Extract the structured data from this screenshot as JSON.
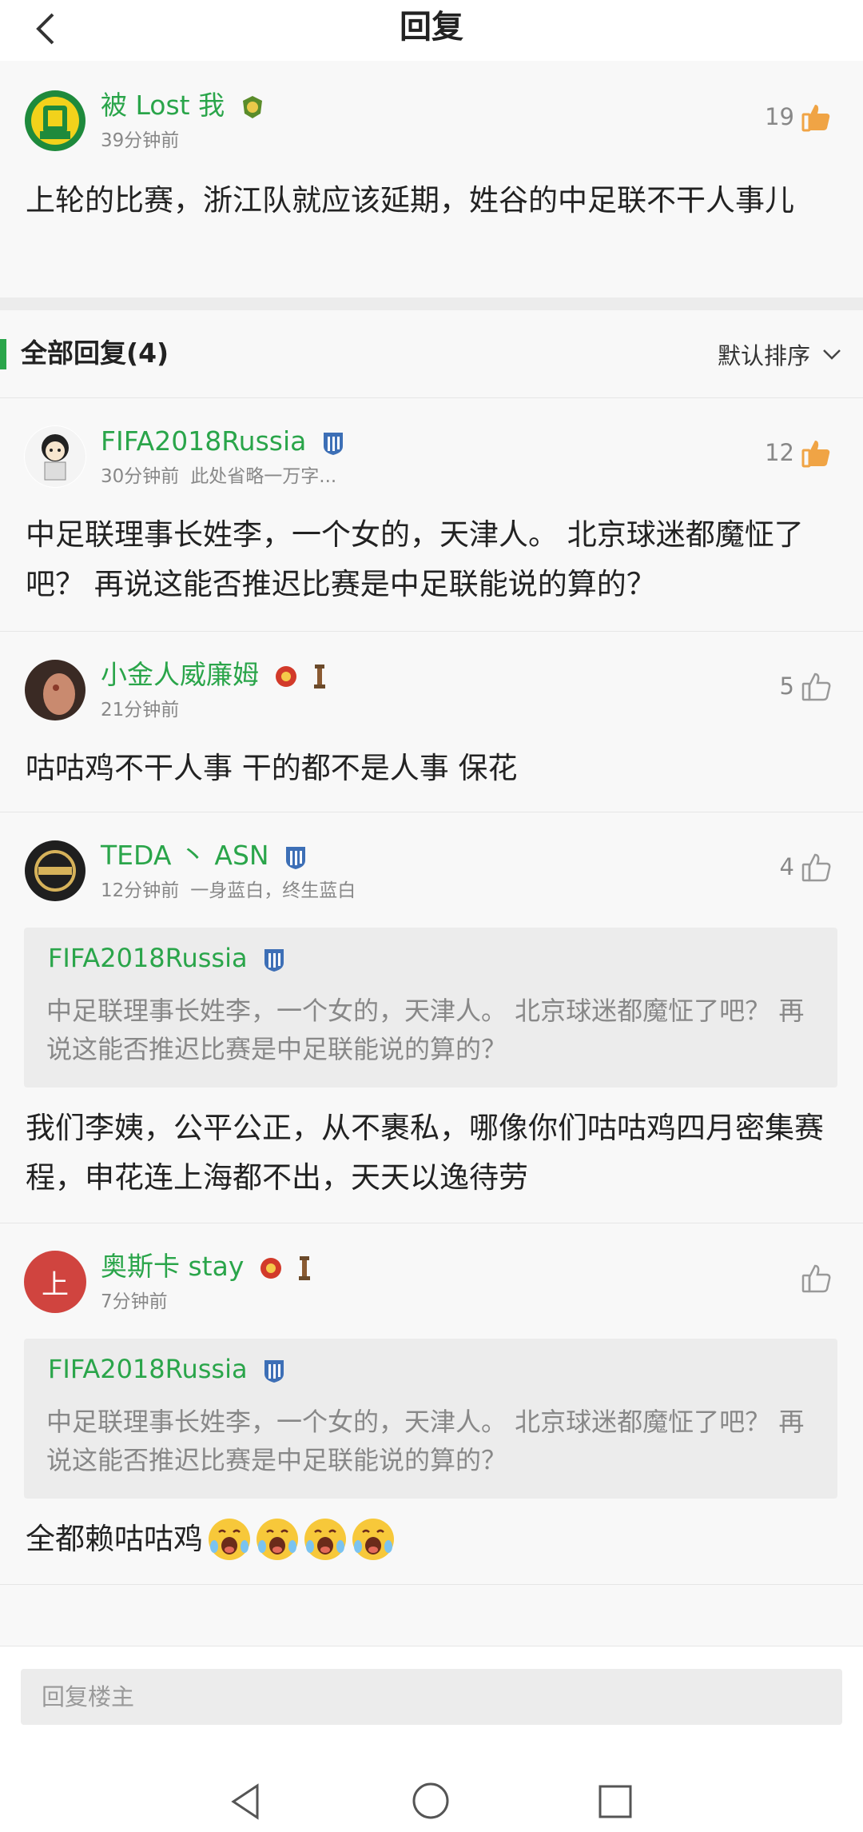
{
  "header": {
    "title": "回复"
  },
  "op": {
    "username": "被 Lost 我",
    "time": "39分钟前",
    "likes": "19",
    "text": "上轮的比赛，浙江队就应该延期，姓谷的中足联不干人事儿"
  },
  "section": {
    "title": "全部回复(4)",
    "sort_label": "默认排序"
  },
  "replies": [
    {
      "username": "FIFA2018Russia",
      "time": "30分钟前",
      "signature": "此处省略一万字...",
      "likes": "12",
      "text": "中足联理事长姓李，一个女的，天津人。 北京球迷都魔怔了吧？ 再说这能否推迟比赛是中足联能说的算的？"
    },
    {
      "username": "小金人威廉姆",
      "time": "21分钟前",
      "likes": "5",
      "text": "咕咕鸡不干人事 干的都不是人事 保花"
    },
    {
      "username": "TEDA 丶 ASN",
      "time": "12分钟前",
      "signature": "一身蓝白，终生蓝白",
      "likes": "4",
      "quote": {
        "username": "FIFA2018Russia",
        "text": "中足联理事长姓李，一个女的，天津人。 北京球迷都魔怔了吧？ 再说这能否推迟比赛是中足联能说的算的？"
      },
      "text": "我们李姨，公平公正，从不裹私，哪像你们咕咕鸡四月密集赛程，申花连上海都不出，天天以逸待劳"
    },
    {
      "username": "奥斯卡 stay",
      "time": "7分钟前",
      "likes": "",
      "avatar_text": "上",
      "quote": {
        "username": "FIFA2018Russia",
        "text": "中足联理事长姓李，一个女的，天津人。 北京球迷都魔怔了吧？ 再说这能否推迟比赛是中足联能说的算的？"
      },
      "text": "全都赖咕咕鸡"
    }
  ],
  "composer": {
    "placeholder": "回复楼主"
  },
  "colors": {
    "accent_green": "#2aa54a",
    "like_orange": "#f0a445",
    "avatar_red": "#d0443f"
  },
  "icons": [
    "back-arrow-icon",
    "thumbs-up-icon",
    "chevron-down-icon",
    "nav-back-icon",
    "nav-home-icon",
    "nav-recent-icon",
    "crying-face-emoji"
  ]
}
